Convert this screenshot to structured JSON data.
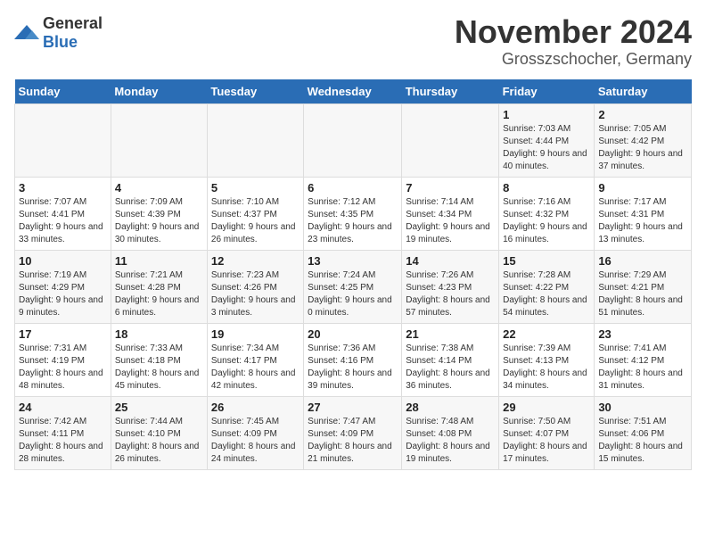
{
  "logo": {
    "general": "General",
    "blue": "Blue"
  },
  "title": "November 2024",
  "subtitle": "Grosszschocher, Germany",
  "days_of_week": [
    "Sunday",
    "Monday",
    "Tuesday",
    "Wednesday",
    "Thursday",
    "Friday",
    "Saturday"
  ],
  "weeks": [
    [
      {
        "day": "",
        "info": ""
      },
      {
        "day": "",
        "info": ""
      },
      {
        "day": "",
        "info": ""
      },
      {
        "day": "",
        "info": ""
      },
      {
        "day": "",
        "info": ""
      },
      {
        "day": "1",
        "info": "Sunrise: 7:03 AM\nSunset: 4:44 PM\nDaylight: 9 hours and 40 minutes."
      },
      {
        "day": "2",
        "info": "Sunrise: 7:05 AM\nSunset: 4:42 PM\nDaylight: 9 hours and 37 minutes."
      }
    ],
    [
      {
        "day": "3",
        "info": "Sunrise: 7:07 AM\nSunset: 4:41 PM\nDaylight: 9 hours and 33 minutes."
      },
      {
        "day": "4",
        "info": "Sunrise: 7:09 AM\nSunset: 4:39 PM\nDaylight: 9 hours and 30 minutes."
      },
      {
        "day": "5",
        "info": "Sunrise: 7:10 AM\nSunset: 4:37 PM\nDaylight: 9 hours and 26 minutes."
      },
      {
        "day": "6",
        "info": "Sunrise: 7:12 AM\nSunset: 4:35 PM\nDaylight: 9 hours and 23 minutes."
      },
      {
        "day": "7",
        "info": "Sunrise: 7:14 AM\nSunset: 4:34 PM\nDaylight: 9 hours and 19 minutes."
      },
      {
        "day": "8",
        "info": "Sunrise: 7:16 AM\nSunset: 4:32 PM\nDaylight: 9 hours and 16 minutes."
      },
      {
        "day": "9",
        "info": "Sunrise: 7:17 AM\nSunset: 4:31 PM\nDaylight: 9 hours and 13 minutes."
      }
    ],
    [
      {
        "day": "10",
        "info": "Sunrise: 7:19 AM\nSunset: 4:29 PM\nDaylight: 9 hours and 9 minutes."
      },
      {
        "day": "11",
        "info": "Sunrise: 7:21 AM\nSunset: 4:28 PM\nDaylight: 9 hours and 6 minutes."
      },
      {
        "day": "12",
        "info": "Sunrise: 7:23 AM\nSunset: 4:26 PM\nDaylight: 9 hours and 3 minutes."
      },
      {
        "day": "13",
        "info": "Sunrise: 7:24 AM\nSunset: 4:25 PM\nDaylight: 9 hours and 0 minutes."
      },
      {
        "day": "14",
        "info": "Sunrise: 7:26 AM\nSunset: 4:23 PM\nDaylight: 8 hours and 57 minutes."
      },
      {
        "day": "15",
        "info": "Sunrise: 7:28 AM\nSunset: 4:22 PM\nDaylight: 8 hours and 54 minutes."
      },
      {
        "day": "16",
        "info": "Sunrise: 7:29 AM\nSunset: 4:21 PM\nDaylight: 8 hours and 51 minutes."
      }
    ],
    [
      {
        "day": "17",
        "info": "Sunrise: 7:31 AM\nSunset: 4:19 PM\nDaylight: 8 hours and 48 minutes."
      },
      {
        "day": "18",
        "info": "Sunrise: 7:33 AM\nSunset: 4:18 PM\nDaylight: 8 hours and 45 minutes."
      },
      {
        "day": "19",
        "info": "Sunrise: 7:34 AM\nSunset: 4:17 PM\nDaylight: 8 hours and 42 minutes."
      },
      {
        "day": "20",
        "info": "Sunrise: 7:36 AM\nSunset: 4:16 PM\nDaylight: 8 hours and 39 minutes."
      },
      {
        "day": "21",
        "info": "Sunrise: 7:38 AM\nSunset: 4:14 PM\nDaylight: 8 hours and 36 minutes."
      },
      {
        "day": "22",
        "info": "Sunrise: 7:39 AM\nSunset: 4:13 PM\nDaylight: 8 hours and 34 minutes."
      },
      {
        "day": "23",
        "info": "Sunrise: 7:41 AM\nSunset: 4:12 PM\nDaylight: 8 hours and 31 minutes."
      }
    ],
    [
      {
        "day": "24",
        "info": "Sunrise: 7:42 AM\nSunset: 4:11 PM\nDaylight: 8 hours and 28 minutes."
      },
      {
        "day": "25",
        "info": "Sunrise: 7:44 AM\nSunset: 4:10 PM\nDaylight: 8 hours and 26 minutes."
      },
      {
        "day": "26",
        "info": "Sunrise: 7:45 AM\nSunset: 4:09 PM\nDaylight: 8 hours and 24 minutes."
      },
      {
        "day": "27",
        "info": "Sunrise: 7:47 AM\nSunset: 4:09 PM\nDaylight: 8 hours and 21 minutes."
      },
      {
        "day": "28",
        "info": "Sunrise: 7:48 AM\nSunset: 4:08 PM\nDaylight: 8 hours and 19 minutes."
      },
      {
        "day": "29",
        "info": "Sunrise: 7:50 AM\nSunset: 4:07 PM\nDaylight: 8 hours and 17 minutes."
      },
      {
        "day": "30",
        "info": "Sunrise: 7:51 AM\nSunset: 4:06 PM\nDaylight: 8 hours and 15 minutes."
      }
    ]
  ]
}
